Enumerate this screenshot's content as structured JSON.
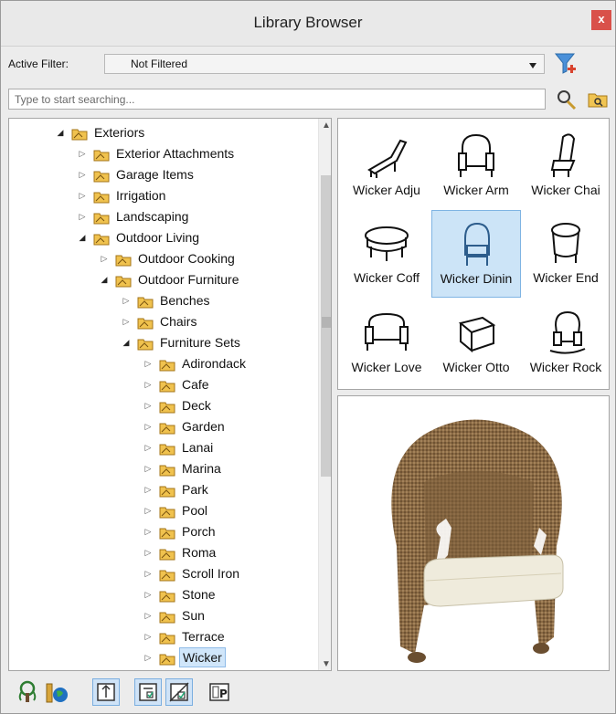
{
  "window": {
    "title": "Library Browser",
    "close_label": "x"
  },
  "filter": {
    "label": "Active Filter:",
    "value": "Not Filtered"
  },
  "search": {
    "placeholder": "Type to start searching..."
  },
  "tree": {
    "items": [
      {
        "label": "Exteriors",
        "level": 0,
        "state": "open"
      },
      {
        "label": "Exterior Attachments",
        "level": 1,
        "state": "closed"
      },
      {
        "label": "Garage Items",
        "level": 1,
        "state": "closed"
      },
      {
        "label": "Irrigation",
        "level": 1,
        "state": "closed"
      },
      {
        "label": "Landscaping",
        "level": 1,
        "state": "closed"
      },
      {
        "label": "Outdoor Living",
        "level": 1,
        "state": "open"
      },
      {
        "label": "Outdoor Cooking",
        "level": 2,
        "state": "closed"
      },
      {
        "label": "Outdoor Furniture",
        "level": 2,
        "state": "open"
      },
      {
        "label": "Benches",
        "level": 3,
        "state": "closed"
      },
      {
        "label": "Chairs",
        "level": 3,
        "state": "closed"
      },
      {
        "label": "Furniture Sets",
        "level": 3,
        "state": "open"
      },
      {
        "label": "Adirondack",
        "level": 4,
        "state": "closed"
      },
      {
        "label": "Cafe",
        "level": 4,
        "state": "closed"
      },
      {
        "label": "Deck",
        "level": 4,
        "state": "closed"
      },
      {
        "label": "Garden",
        "level": 4,
        "state": "closed"
      },
      {
        "label": "Lanai",
        "level": 4,
        "state": "closed"
      },
      {
        "label": "Marina",
        "level": 4,
        "state": "closed"
      },
      {
        "label": "Park",
        "level": 4,
        "state": "closed"
      },
      {
        "label": "Pool",
        "level": 4,
        "state": "closed"
      },
      {
        "label": "Porch",
        "level": 4,
        "state": "closed"
      },
      {
        "label": "Roma",
        "level": 4,
        "state": "closed"
      },
      {
        "label": "Scroll Iron",
        "level": 4,
        "state": "closed"
      },
      {
        "label": "Stone",
        "level": 4,
        "state": "closed"
      },
      {
        "label": "Sun",
        "level": 4,
        "state": "closed"
      },
      {
        "label": "Terrace",
        "level": 4,
        "state": "closed"
      },
      {
        "label": "Wicker",
        "level": 4,
        "state": "closed",
        "selected": true
      }
    ]
  },
  "thumbnails": [
    {
      "label": "Wicker Adju",
      "icon": "chaise-lounge-icon"
    },
    {
      "label": "Wicker Arm",
      "icon": "armchair-icon"
    },
    {
      "label": "Wicker Chai",
      "icon": "chair-icon"
    },
    {
      "label": "Wicker Coff",
      "icon": "coffee-table-icon"
    },
    {
      "label": "Wicker Dinin",
      "icon": "dining-chair-icon",
      "selected": true
    },
    {
      "label": "Wicker End",
      "icon": "end-table-icon"
    },
    {
      "label": "Wicker Love",
      "icon": "loveseat-icon"
    },
    {
      "label": "Wicker Otto",
      "icon": "ottoman-icon"
    },
    {
      "label": "Wicker Rock",
      "icon": "rocking-chair-icon"
    }
  ],
  "preview": {
    "subject": "wicker-dining-chair-preview"
  },
  "toolbar": {
    "buttons": [
      {
        "name": "tree-view-icon",
        "toggled": false
      },
      {
        "name": "library-globe-icon",
        "toggled": false
      },
      {
        "name": "sort-view-icon",
        "toggled": true
      },
      {
        "name": "checklist-view-icon",
        "toggled": true
      },
      {
        "name": "filter-check-icon",
        "toggled": true
      },
      {
        "name": "properties-icon",
        "toggled": false
      }
    ]
  },
  "colors": {
    "selection": "#cce4f7",
    "selection_border": "#7fb4e3",
    "folder": "#e8b84a",
    "close": "#d9514a"
  }
}
